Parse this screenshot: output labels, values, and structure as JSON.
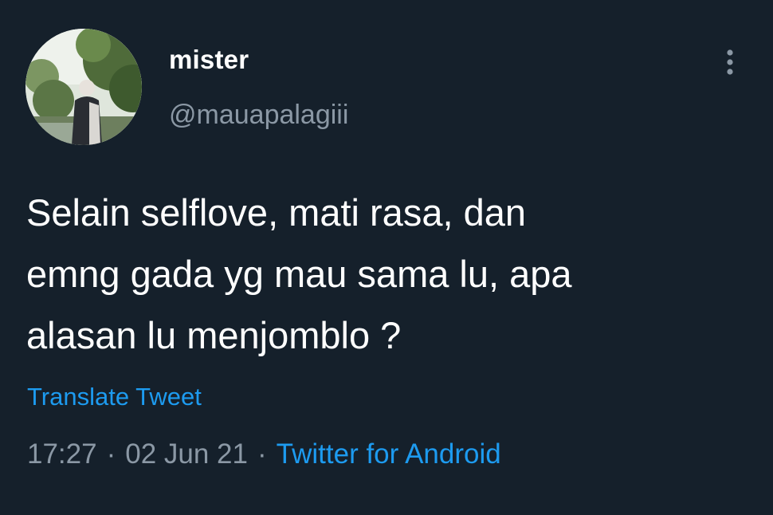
{
  "user": {
    "display_name": "mister",
    "handle": "@mauapalagiii"
  },
  "tweet": {
    "text": "Selain selflove, mati rasa, dan\nemng gada yg mau sama lu, apa\nalasan lu menjomblo ?",
    "translate_label": "Translate Tweet",
    "time": "17:27",
    "date": "02 Jun 21",
    "separator": "·",
    "source": "Twitter for Android"
  },
  "icons": {
    "more": "more-vertical-icon",
    "avatar": "profile-photo"
  },
  "colors": {
    "background": "#15202b",
    "text_primary": "#ffffff",
    "text_secondary": "#8b98a5",
    "accent": "#1d9bf0"
  }
}
